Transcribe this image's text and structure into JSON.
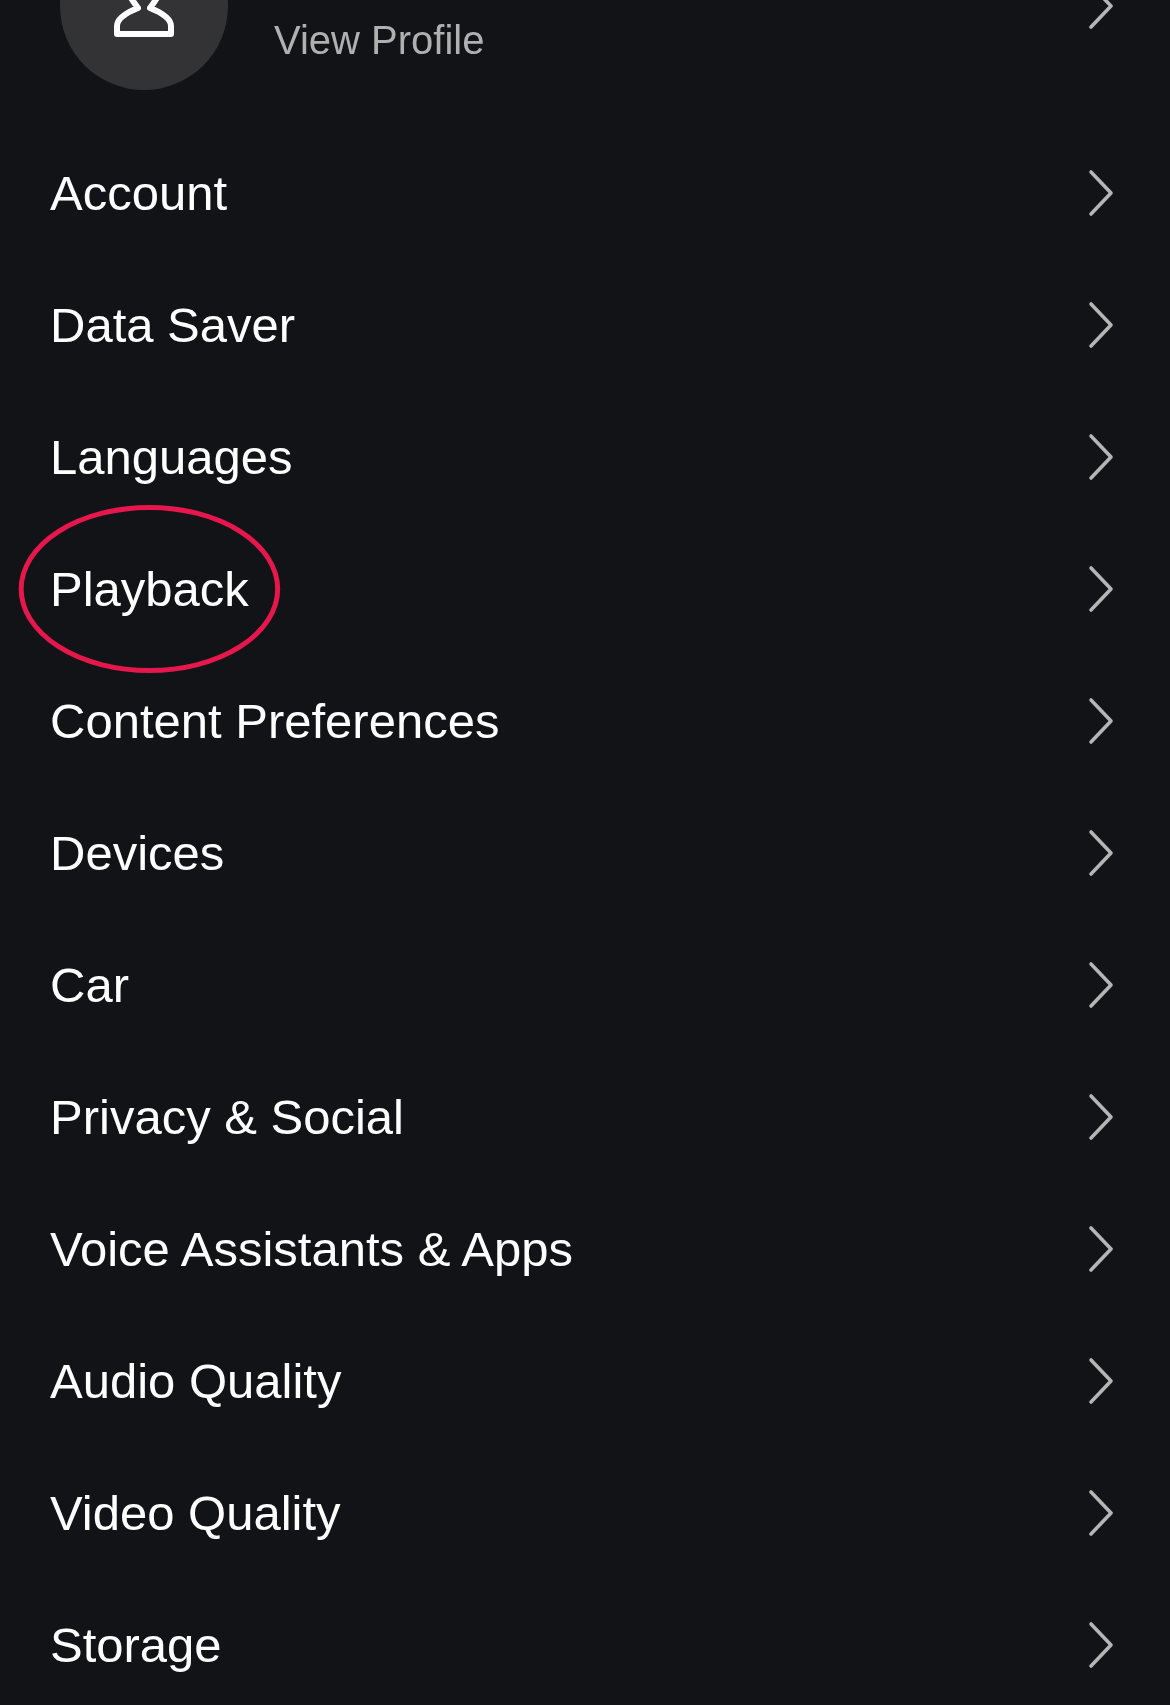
{
  "profile": {
    "subtitle": "View Profile"
  },
  "menu": {
    "items": [
      {
        "label": "Account",
        "circled": false
      },
      {
        "label": "Data Saver",
        "circled": false
      },
      {
        "label": "Languages",
        "circled": false
      },
      {
        "label": "Playback",
        "circled": true
      },
      {
        "label": "Content Preferences",
        "circled": false
      },
      {
        "label": "Devices",
        "circled": false
      },
      {
        "label": "Car",
        "circled": false
      },
      {
        "label": "Privacy & Social",
        "circled": false
      },
      {
        "label": "Voice Assistants & Apps",
        "circled": false
      },
      {
        "label": "Audio Quality",
        "circled": false
      },
      {
        "label": "Video Quality",
        "circled": false
      },
      {
        "label": "Storage",
        "circled": false
      }
    ]
  }
}
